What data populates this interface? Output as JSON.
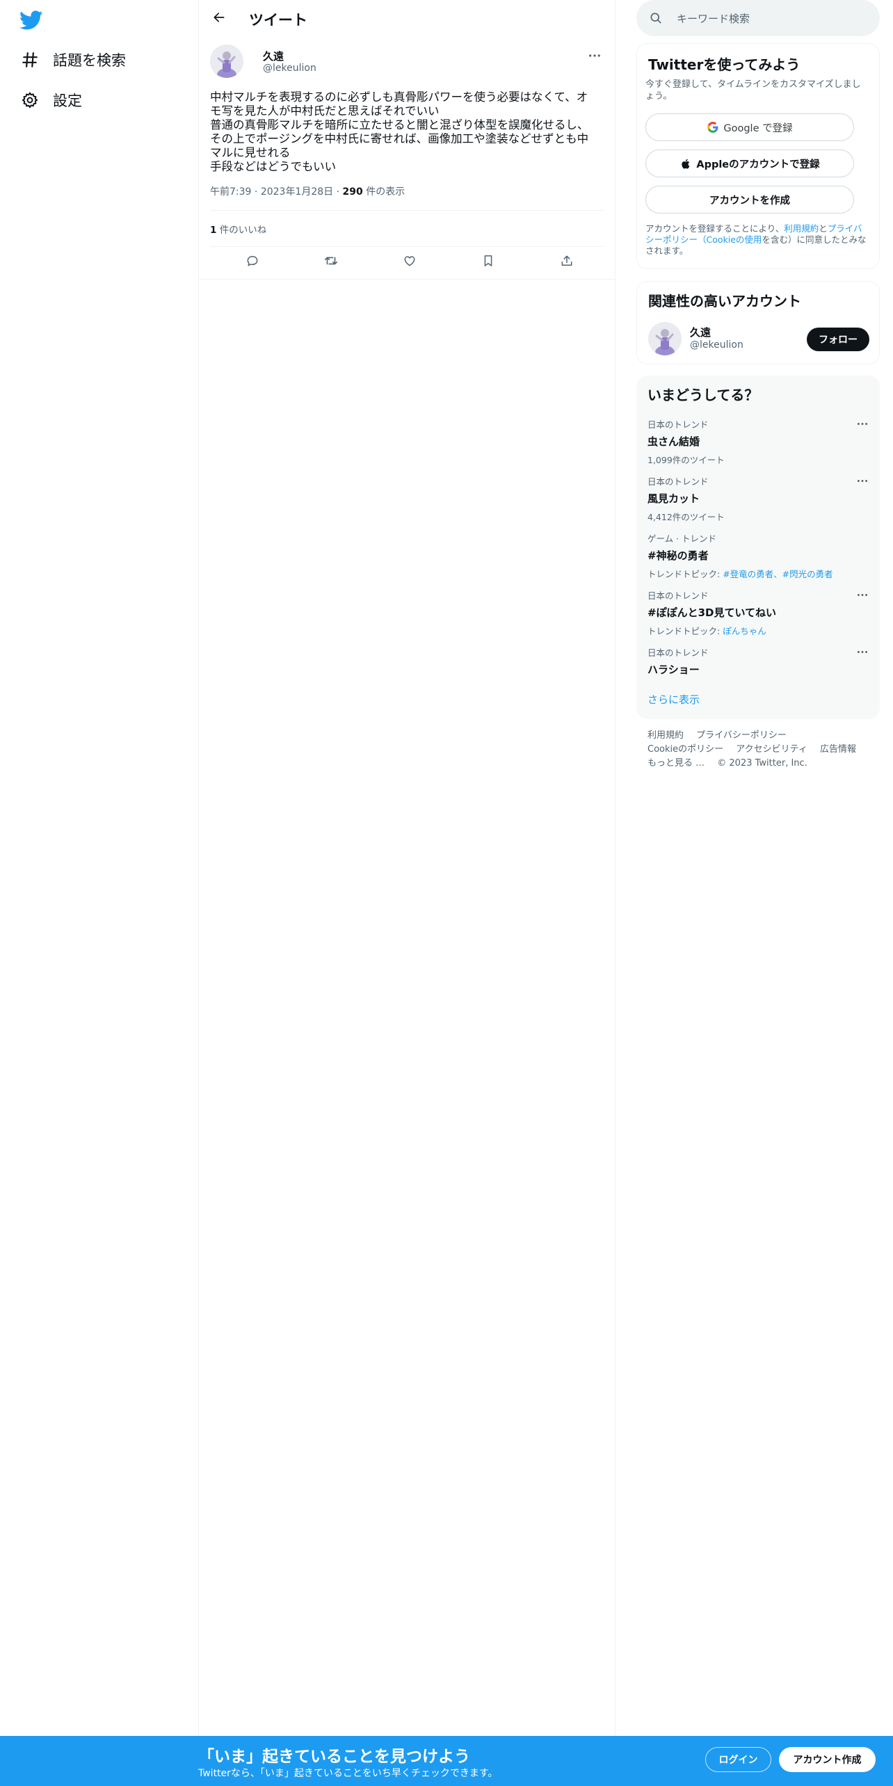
{
  "nav": {
    "logo_icon": "twitter-bird-icon",
    "items": [
      {
        "label": "話題を検索",
        "icon": "hashtag-icon"
      },
      {
        "label": "設定",
        "icon": "gear-icon"
      }
    ]
  },
  "header": {
    "title": "ツイート",
    "back_icon": "arrow-left-icon"
  },
  "tweet": {
    "author_name": "久遠",
    "author_handle": "@lekeulion",
    "lines": [
      "中村マルチを表現するのに必ずしも真骨彫パワーを使う必要はなくて、オ",
      "モ写を見た人が中村氏だと思えばそれでいい",
      "普通の真骨彫マルチを暗所に立たせると闇と混ざり体型を誤魔化せるし、",
      "その上でポージングを中村氏に寄せれば、画像加工や塗装などせずとも中",
      "マルに見せれる",
      "手段などはどうでもいい"
    ],
    "time": "午前7:39",
    "date": "2023年1月28日",
    "views_count": "290",
    "views_label": "件の表示",
    "likes_count": "1",
    "likes_label": "件のいいね",
    "actions": [
      "reply-icon",
      "retweet-icon",
      "like-icon",
      "bookmark-icon",
      "share-icon"
    ]
  },
  "search": {
    "placeholder": "キーワード検索"
  },
  "signup": {
    "title": "Twitterを使ってみよう",
    "subtitle": "今すぐ登録して、タイムラインをカスタマイズしましょう。",
    "google_label": "Google で登録",
    "apple_label": "Appleのアカウントで登録",
    "create_label": "アカウントを作成",
    "terms_prefix": "アカウントを登録することにより、",
    "terms_link": "利用規約",
    "terms_and": "と",
    "privacy_link": "プライバシーポリシー（Cookieの使用",
    "terms_suffix": "を含む）に同意したとみなされます。"
  },
  "relevant": {
    "title": "関連性の高いアカウント",
    "name": "久遠",
    "handle": "@lekeulion",
    "follow_label": "フォロー"
  },
  "trends": {
    "title": "いまどうしてる？",
    "items": [
      {
        "context": "日本のトレンド",
        "name": "虫さん結婚",
        "sub": "1,099件のツイート"
      },
      {
        "context": "日本のトレンド",
        "name": "風見カット",
        "sub": "4,412件のツイート"
      },
      {
        "context": "ゲーム · トレンド",
        "name": "#神秘の勇者",
        "sub_prefix": "トレンドトピック: ",
        "sub_links": "#登竜の勇者、#閃光の勇者"
      },
      {
        "context": "日本のトレンド",
        "name": "#ぽぽんと3D見ていてねい",
        "sub_prefix": "トレンドトピック: ",
        "sub_links": "ぽんちゃん"
      },
      {
        "context": "日本のトレンド",
        "name": "ハラショー"
      }
    ],
    "show_more": "さらに表示"
  },
  "footer": {
    "links": [
      "利用規約",
      "プライバシーポリシー",
      "Cookieのポリシー",
      "アクセシビリティ",
      "広告情報",
      "もっと見る …"
    ],
    "copyright": "© 2023 Twitter, Inc."
  },
  "banner": {
    "title": "「いま」起きていることを見つけよう",
    "subtitle": "Twitterなら、「いま」起きていることをいち早くチェックできます。",
    "login_label": "ログイン",
    "signup_label": "アカウント作成"
  },
  "colors": {
    "accent": "#1d9bf0",
    "text": "#0f1419",
    "muted": "#536471",
    "border": "#eff3f4"
  }
}
